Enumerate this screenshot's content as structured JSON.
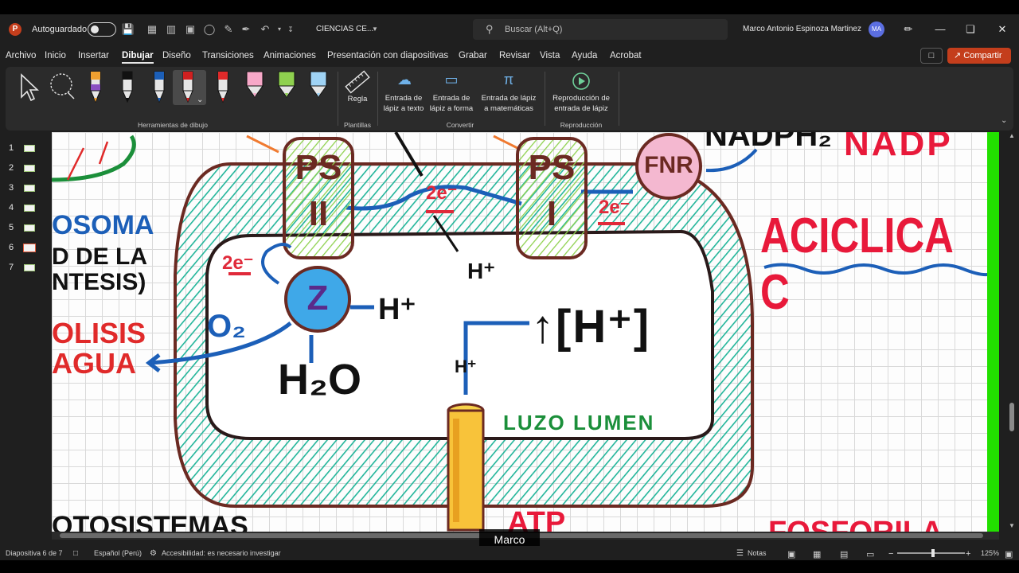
{
  "titlebar": {
    "autosave_label": "Autoguardado",
    "doc_title": "CIENCIAS CE...",
    "search_placeholder": "Buscar (Alt+Q)",
    "user_name": "Marco Antonio Espinoza Martinez",
    "avatar_initials": "MA"
  },
  "menu": {
    "tabs": [
      "Archivo",
      "Inicio",
      "Insertar",
      "Dibujar",
      "Diseño",
      "Transiciones",
      "Animaciones",
      "Presentación con diapositivas",
      "Grabar",
      "Revisar",
      "Vista",
      "Ayuda",
      "Acrobat"
    ],
    "active_tab": "Dibujar",
    "share_label": "Compartir"
  },
  "ribbon": {
    "groups": {
      "drawing_tools": "Herramientas de dibujo",
      "stencils": "Plantillas",
      "convert": "Convertir",
      "replay": "Reproducción"
    },
    "pens": [
      {
        "name": "pen-orange",
        "color": "#f0a030",
        "band": "#8a4fc2"
      },
      {
        "name": "pen-black",
        "color": "#111111"
      },
      {
        "name": "pen-blue",
        "color": "#1c5fb8"
      },
      {
        "name": "pen-red",
        "color": "#d02020"
      },
      {
        "name": "pen-red-2",
        "color": "#e02a2a"
      },
      {
        "name": "highlighter-pink",
        "color": "#f7a8c8"
      },
      {
        "name": "highlighter-green",
        "color": "#8fd14f"
      },
      {
        "name": "highlighter-lightblue",
        "color": "#9fd3f5"
      }
    ],
    "ruler_label": "Regla",
    "text_ink": {
      "line1": "Entrada de",
      "line2": "lápiz a texto"
    },
    "shape_ink": {
      "line1": "Entrada de",
      "line2": "lápiz a forma"
    },
    "math_ink": {
      "line1": "Entrada de lápiz",
      "line2": "a matemáticas"
    },
    "replay_ink": {
      "line1": "Reproducción de",
      "line2": "entrada de lápiz"
    }
  },
  "slides": {
    "numbers": [
      "1",
      "2",
      "3",
      "4",
      "5",
      "6",
      "7"
    ],
    "active": "6"
  },
  "slide_content": {
    "ps2_top": "PS",
    "ps2_bottom": "II",
    "ps1_top": "PS",
    "ps1_bottom": "I",
    "fnr": "FNR",
    "electrons": "2e⁻",
    "z": "Z",
    "h_plus": "H⁺",
    "o2": "O₂",
    "h2o": "H₂O",
    "h_conc": "↑[H⁺]",
    "lumen": "LUZO LUMEN",
    "aciclica": "ACICLICA C",
    "nadp": "NADP",
    "nadph": "NADPH₂",
    "left_soma": "OSOMA",
    "left_dela": "D DE LA",
    "left_ntesis": "NTESIS)",
    "left_olisis": "OLISIS",
    "left_agua": "AGUA",
    "bottom_left": "OTOSISTEMAS",
    "bottom_atp": "ATP",
    "bottom_fosforila": "FOSFORILA"
  },
  "colors": {
    "accent_share": "#c43e1c",
    "membrane_green": "#22b59a",
    "pen_blue": "#1c5fb8",
    "pen_red": "#e02a3a",
    "title_red": "#e8193a",
    "lumen_green": "#1b8f3a",
    "brown": "#6b2a22",
    "slide_edge_green": "#22e000"
  },
  "caption": "Marco",
  "status": {
    "slide_info": "Diapositiva 6 de 7",
    "language": "Español (Perú)",
    "accessibility": "Accesibilidad: es necesario investigar",
    "notes": "Notas",
    "zoom": "125%"
  }
}
